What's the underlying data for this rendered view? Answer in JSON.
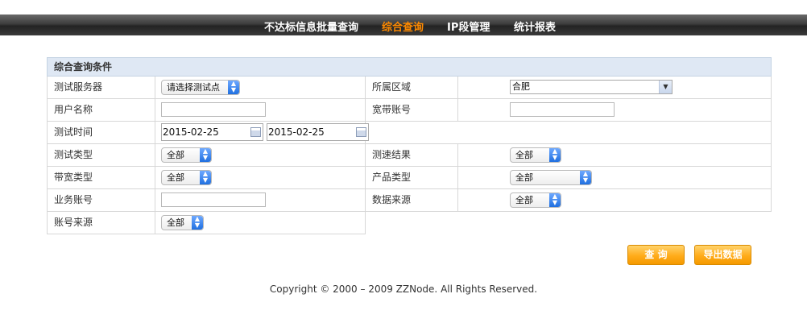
{
  "nav": {
    "items": [
      {
        "label": "不达标信息批量查询",
        "active": false
      },
      {
        "label": "综合查询",
        "active": true
      },
      {
        "label": "IP段管理",
        "active": false
      },
      {
        "label": "统计报表",
        "active": false
      }
    ],
    "active_color": "#ff8a00"
  },
  "form": {
    "title": "综合查询条件",
    "test_server": {
      "label": "测试服务器",
      "value": "请选择测试点"
    },
    "region": {
      "label": "所属区域",
      "value": "合肥"
    },
    "user_name": {
      "label": "用户名称",
      "value": ""
    },
    "broadband_account": {
      "label": "宽带账号",
      "value": ""
    },
    "test_time": {
      "label": "测试时间",
      "start": "2015-02-25",
      "end": "2015-02-25"
    },
    "test_type": {
      "label": "测试类型",
      "value": "全部"
    },
    "speed_result": {
      "label": "测速结果",
      "value": "全部"
    },
    "bandwidth_type": {
      "label": "带宽类型",
      "value": "全部"
    },
    "product_type": {
      "label": "产品类型",
      "value": "全部"
    },
    "business_account": {
      "label": "业务账号",
      "value": ""
    },
    "data_source": {
      "label": "数据来源",
      "value": "全部"
    },
    "account_source": {
      "label": "账号来源",
      "value": "全部"
    }
  },
  "buttons": {
    "query": "查 询",
    "export": "导出数据"
  },
  "footer": "Copyright © 2000 – 2009 ZZNode. All Rights Reserved.",
  "colors": {
    "header_bg": "#dfe8f4",
    "button": "#ffab1a"
  }
}
